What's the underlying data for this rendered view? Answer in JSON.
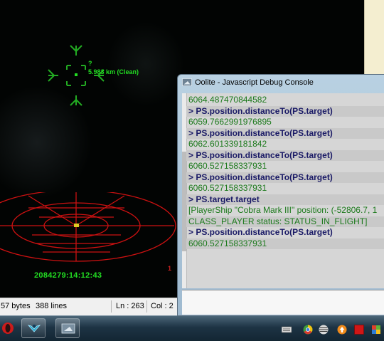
{
  "game": {
    "target_label": "5.983 km (Clean)",
    "target_marker": "?",
    "clock": "2084279:14:12:43",
    "side_marker": "1"
  },
  "editor_status": {
    "size": "57 bytes",
    "lines": "388 lines",
    "line_pos": "Ln : 263",
    "col_pos": "Col : 2"
  },
  "console": {
    "title": "Oolite - Javascript Debug Console",
    "lines": [
      {
        "kind": "out",
        "text": "6064.487470844582"
      },
      {
        "kind": "cmd",
        "text": "> PS.position.distanceTo(PS.target)"
      },
      {
        "kind": "out",
        "text": "6059.7662991976895"
      },
      {
        "kind": "cmd",
        "text": "> PS.position.distanceTo(PS.target)"
      },
      {
        "kind": "out",
        "text": "6062.601339181842"
      },
      {
        "kind": "cmd",
        "text": "> PS.position.distanceTo(PS.target)"
      },
      {
        "kind": "out",
        "text": "6060.527158337931"
      },
      {
        "kind": "cmd",
        "text": "> PS.position.distanceTo(PS.target)"
      },
      {
        "kind": "out",
        "text": "6060.527158337931"
      },
      {
        "kind": "cmd",
        "text": "> PS.target.target"
      },
      {
        "kind": "out",
        "text": "[PlayerShip \"Cobra Mark III\" position: (-52806.7, 1"
      },
      {
        "kind": "out",
        "text": "CLASS_PLAYER status: STATUS_IN_FLIGHT]"
      },
      {
        "kind": "cmd",
        "text": "> PS.position.distanceTo(PS.target)"
      },
      {
        "kind": "out",
        "text": "6060.527158337931"
      }
    ]
  },
  "taskbar": {
    "icons": [
      "opera-icon",
      "oolite-icon",
      "debug-console-icon"
    ],
    "tray": [
      "keyboard-icon",
      "chrome-icon",
      "att-icon",
      "updates-icon",
      "red-square-icon",
      "flag-icon"
    ]
  },
  "colors": {
    "hud_green": "#22dd22",
    "scanner_red": "#cc1111",
    "console_output": "#1c7a1c",
    "console_command": "#1a1a66"
  }
}
